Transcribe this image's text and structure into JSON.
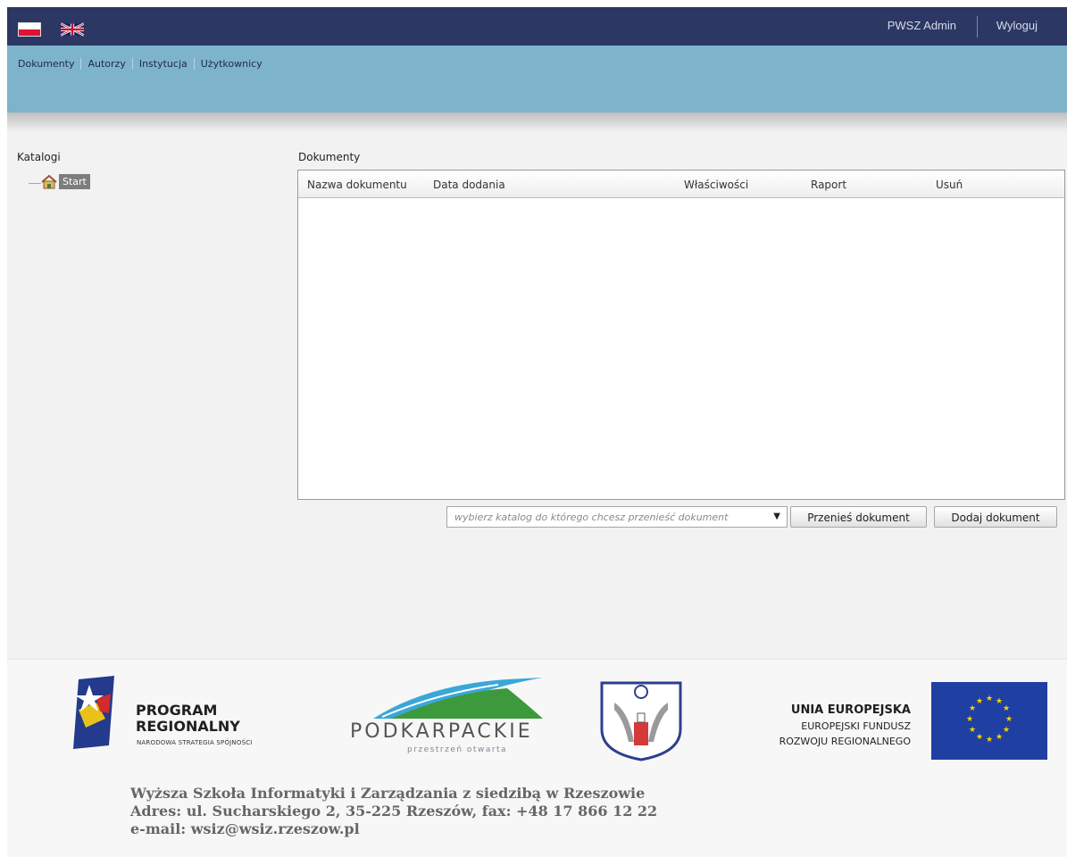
{
  "header": {
    "languages": [
      {
        "name": "pl-flag-icon",
        "colors": [
          "#ffffff",
          "#dc1432"
        ]
      },
      {
        "name": "uk-flag-icon",
        "colors": [
          "#012169",
          "#ffffff",
          "#c8102e"
        ]
      }
    ],
    "user_label": "PWSZ Admin",
    "logout_label": "Wyloguj"
  },
  "nav": {
    "items": [
      "Dokumenty",
      "Autorzy",
      "Instytucja",
      "Użytkownicy"
    ]
  },
  "sidebar": {
    "title": "Katalogi",
    "tree_root": "Start",
    "tree_icon": "home-icon"
  },
  "documents": {
    "title": "Dokumenty",
    "columns": [
      "Nazwa dokumentu",
      "Data dodania",
      "Właściwości",
      "Raport",
      "Usuń"
    ],
    "rows": [],
    "move_select_placeholder": "wybierz katalog do którego chcesz przenieść dokument",
    "move_button": "Przenieś dokument",
    "add_button": "Dodaj dokument"
  },
  "footer": {
    "program": {
      "line1": "PROGRAM",
      "line2": "REGIONALNY",
      "sub": "NARODOWA STRATEGIA SPÓJNOŚCI"
    },
    "podkarpackie": {
      "title": "PODKARPACKIE",
      "sub": "przestrzeń otwarta"
    },
    "ue": {
      "title": "UNIA EUROPEJSKA",
      "line1": "EUROPEJSKI FUNDUSZ",
      "line2": "ROZWOJU REGIONALNEGO"
    },
    "address": [
      "Wyższa Szkoła Informatyki i Zarządzania z siedzibą w Rzeszowie",
      "Adres: ul. Sucharskiego 2, 35-225 Rzeszów, fax: +48 17 866 12 22",
      "e-mail: wsiz@wsiz.rzeszow.pl"
    ]
  },
  "colors": {
    "topbar": "#2c3764",
    "navband": "#7db4cb",
    "content_bg": "#f2f2f2"
  }
}
